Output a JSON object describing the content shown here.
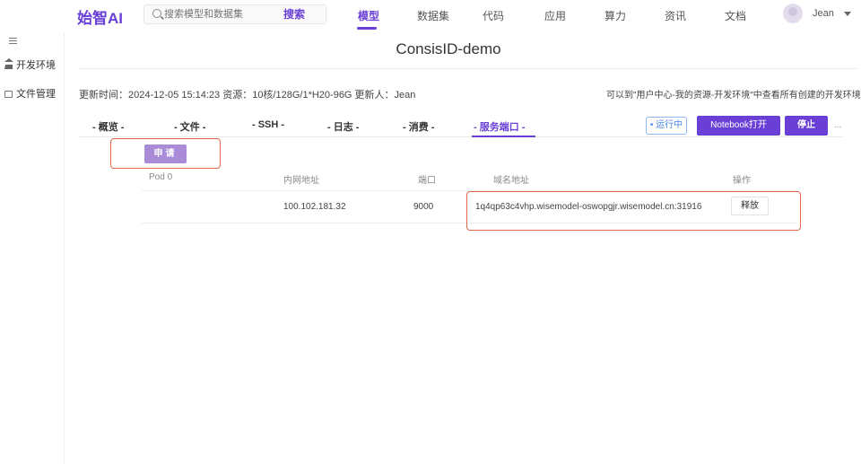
{
  "brand": {
    "logo": "始智AI"
  },
  "search": {
    "placeholder": "搜索模型和数据集",
    "button_label": "搜索"
  },
  "nav": {
    "items": [
      {
        "label": "模型",
        "active": true
      },
      {
        "label": "数据集",
        "active": false
      },
      {
        "label": "代码",
        "active": false
      },
      {
        "label": "应用",
        "active": false
      },
      {
        "label": "算力",
        "active": false
      },
      {
        "label": "资讯",
        "active": false
      },
      {
        "label": "文档",
        "active": false
      }
    ],
    "user": "Jean"
  },
  "sidebar": {
    "items": [
      {
        "label": "开发环境",
        "icon": "home-icon"
      },
      {
        "label": "文件管理",
        "icon": "folder-icon"
      }
    ]
  },
  "page": {
    "title": "ConsisID-demo",
    "meta": "更新时间：2024-12-05 15:14:23 资源：10核/128G/1*H20-96G 更新人：Jean",
    "hint": "可以到\"用户中心-我的资源-开发环境\"中查看所有创建的开发环境"
  },
  "tabs": [
    {
      "label": "- 概览 -"
    },
    {
      "label": "- 文件 -"
    },
    {
      "label": "- SSH -"
    },
    {
      "label": "- 日志 -"
    },
    {
      "label": "- 消费 -"
    },
    {
      "label": "- 服务端口 -",
      "active": true
    }
  ],
  "actions": {
    "status": "• 运行中",
    "notebook": "Notebook打开",
    "stop": "停止",
    "more": "..."
  },
  "ports": {
    "apply_label": "申请",
    "headers": [
      "Pod 0",
      "内网地址",
      "端口",
      "域名地址",
      "操作"
    ],
    "rows": [
      {
        "pod": "",
        "internal_address": "100.102.181.32",
        "port": "9000",
        "domain": "1q4qp63c4vhp.wisemodel-oswopgjr.wisemodel.cn:31916",
        "action": "释放"
      }
    ]
  },
  "colors": {
    "accent": "#6a3fd6",
    "highlight_frame": "#e0654b",
    "apply_button": "#a98bd8",
    "status_blue": "#4a85dd"
  }
}
